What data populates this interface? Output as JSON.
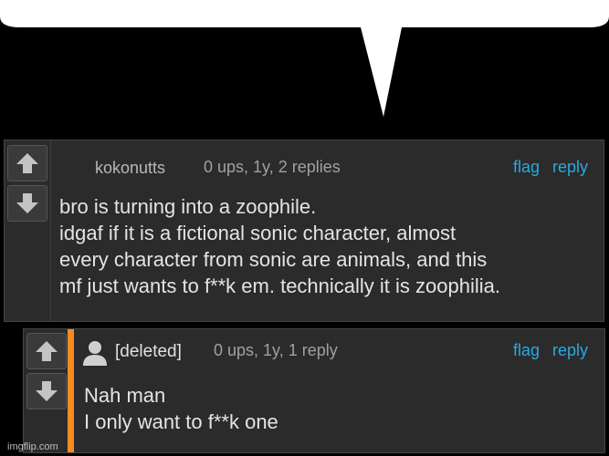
{
  "comment": {
    "username": "kokonutts",
    "meta": "0 ups, 1y, 2 replies",
    "flag_label": "flag",
    "reply_label": "reply",
    "lines": [
      "bro is turning into a zoophile.",
      "idgaf if it is a fictional sonic character, almost",
      "every character from sonic are animals, and this",
      "mf just wants to f**k em. technically it is zoophilia."
    ]
  },
  "reply": {
    "username": "[deleted]",
    "meta": "0 ups, 1y, 1 reply",
    "flag_label": "flag",
    "reply_label": "reply",
    "lines": [
      "Nah man",
      "I only want to f**k one"
    ]
  },
  "watermark": "imgflip.com",
  "colors": {
    "link": "#29a9e1",
    "reply_accent": "#f68b1f",
    "comment_bg": "#2b2b2b"
  },
  "icons": {
    "upvote": "arrow-up-icon",
    "downvote": "arrow-down-icon",
    "avatar": "user-silhouette-icon"
  }
}
